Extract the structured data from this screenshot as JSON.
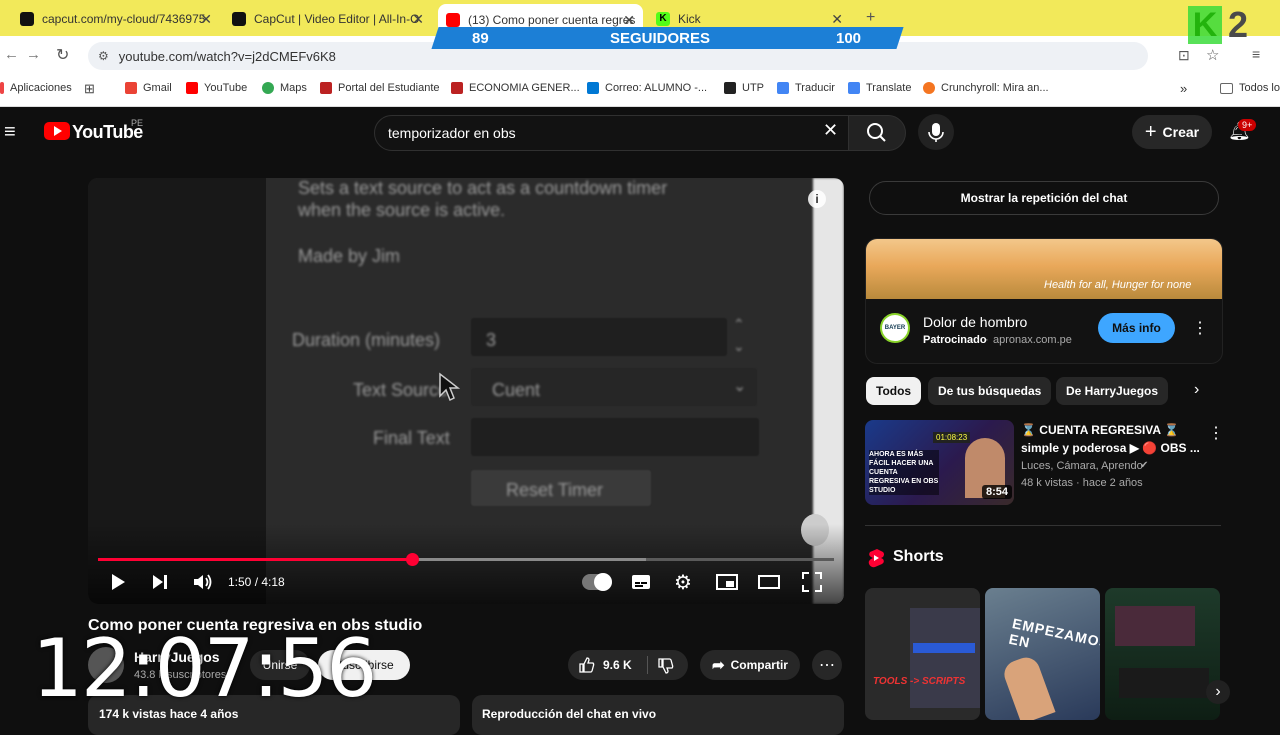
{
  "browser": {
    "tabs": [
      {
        "title": "capcut.com/my-cloud/7436975",
        "icon": "capcut-icon"
      },
      {
        "title": "CapCut | Video Editor | All-In-O",
        "icon": "capcut-icon"
      },
      {
        "title": "(13) Como poner cuenta regres",
        "icon": "youtube-icon"
      },
      {
        "title": "Kick",
        "icon": "kick-icon"
      }
    ],
    "url": "youtube.com/watch?v=j2dCMEFv6K8",
    "bookmarks": [
      "Aplicaciones",
      "Gmail",
      "YouTube",
      "Maps",
      "Portal del Estudiante",
      "ECONOMIA GENER...",
      "Correo: ALUMNO -...",
      "UTP",
      "Traducir",
      "Translate",
      "Crunchyroll: Mira an..."
    ],
    "bookmarks_overflow": "»",
    "bookmarks_folder": "Todos lo"
  },
  "overlay": {
    "left_count": "89",
    "label": "SEGUIDORES",
    "right_count": "100",
    "corner_k": "K",
    "corner_num": "2",
    "clock": "12:07:56"
  },
  "youtube": {
    "logo": "YouTube",
    "region": "PE",
    "search_value": "temporizador en obs",
    "create_label": "Crear",
    "notif_badge": "9+"
  },
  "video": {
    "text_line1": "Sets a text source to act as a countdown timer",
    "text_line2": "when the source is active.",
    "made_by": "Made by Jim",
    "duration_label": "Duration (minutes)",
    "duration_value": "3",
    "text_source_label": "Text Source",
    "text_source_value": "Cuent",
    "final_text_label": "Final Text",
    "reset_label": "Reset Timer",
    "time": "1:50 / 4:18",
    "progress": 0.426
  },
  "below": {
    "title": "Como poner cuenta regresiva en obs studio",
    "channel": "HarryJuegos",
    "subs": "43.8 k suscriptores",
    "join": "Unirse",
    "subscribe": "Suscribirse",
    "likes": "9.6 K",
    "share": "Compartir",
    "desc_meta": "174 k vistas  hace 4 años",
    "chat_replay": "Reproducción del chat en vivo"
  },
  "sidebar": {
    "chat_replay": "Mostrar la repetición del chat",
    "ad": {
      "slogan": "Health for all, Hunger for none",
      "brand": "BAYER",
      "title": "Dolor de hombro",
      "sponsored": "Patrocinado",
      "domain": "apronax.com.pe",
      "cta": "Más info"
    },
    "chips": [
      "Todos",
      "De tus búsquedas",
      "De HarryJuegos"
    ],
    "rec": {
      "title_line1": "⌛ CUENTA REGRESIVA ⌛",
      "title_line2": "simple y poderosa ▶ 🔴 OBS ...",
      "channel": "Luces, Cámara, Aprendo",
      "meta": "48 k vistas · hace 2 años",
      "duration": "8:54",
      "thumb_text": "AHORA ES MÁS FÁCIL HACER UNA CUENTA REGRESIVA EN OBS STUDIO",
      "thumb_timer": "01:08:23"
    },
    "shorts_title": "Shorts",
    "short1_text": "TOOLS -> SCRIPTS",
    "short2_text": "EMPEZAMOS EN"
  }
}
